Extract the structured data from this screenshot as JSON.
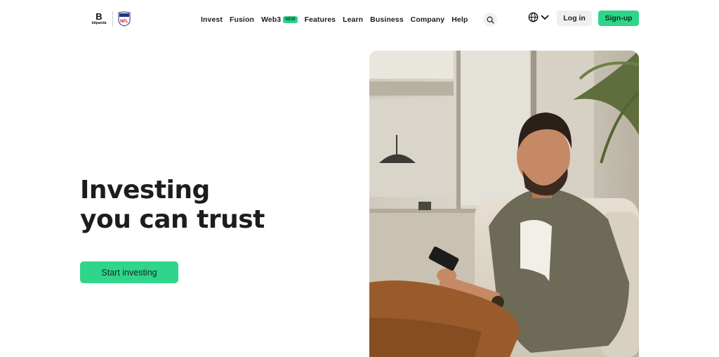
{
  "header": {
    "logo_wordmark": "bitpanda",
    "logo_letter": "B",
    "partner_logo": "NFL",
    "nav_items": [
      "Invest",
      "Fusion",
      "Web3",
      "Features",
      "Learn",
      "Business",
      "Company",
      "Help"
    ],
    "web3_badge": "NEW",
    "search_icon": "search-icon",
    "language_icon": "globe-icon",
    "login_label": "Log in",
    "signup_label": "Sign-up",
    "accent_color": "#2fd58a"
  },
  "hero": {
    "title_line1": "Investing",
    "title_line2": "you can trust",
    "cta_label": "Start investing",
    "image": "man-using-smartphone-on-sofa"
  }
}
